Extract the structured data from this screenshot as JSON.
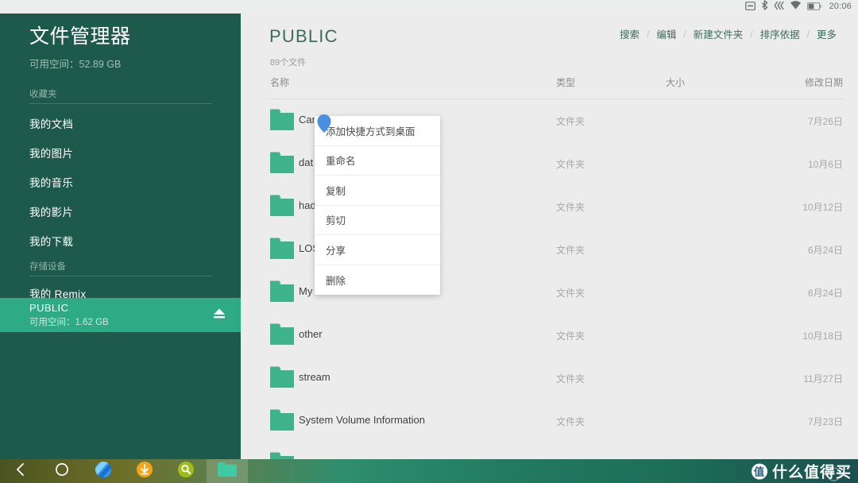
{
  "statusbar": {
    "time": "20:06",
    "icons": [
      "screencast-icon",
      "bluetooth-icon",
      "sync-icon",
      "wifi-icon",
      "battery-icon"
    ]
  },
  "sidebar": {
    "title": "文件管理器",
    "subtitle": "可用空间：52.89 GB",
    "sections": [
      {
        "label": "收藏夹"
      },
      {
        "label": "存储设备"
      }
    ],
    "favorites": [
      {
        "label": "我的文档"
      },
      {
        "label": "我的图片"
      },
      {
        "label": "我的音乐"
      },
      {
        "label": "我的影片"
      },
      {
        "label": "我的下载"
      }
    ],
    "storage": [
      {
        "label": "我的 Remix",
        "active": false
      },
      {
        "label": "PUBLIC",
        "sublabel": "可用空间：1.62 GB",
        "active": true,
        "eject": "eject-icon"
      }
    ],
    "bg_color": "#1e5a4b",
    "active_color": "#2eab84"
  },
  "main": {
    "title": "PUBLIC",
    "count": "89个文件",
    "actions": [
      {
        "label": "搜索"
      },
      {
        "label": "编辑"
      },
      {
        "label": "新建文件夹"
      },
      {
        "label": "排序依据"
      },
      {
        "label": "更多"
      }
    ],
    "action_separator": "/",
    "columns": {
      "name": "名称",
      "type": "类型",
      "size": "大小",
      "date": "修改日期"
    },
    "files": [
      {
        "name": "Camera",
        "type": "文件夹",
        "size": "",
        "date": "7月26日"
      },
      {
        "name": "dat",
        "type": "文件夹",
        "size": "",
        "date": "10月6日"
      },
      {
        "name": "had",
        "type": "文件夹",
        "size": "",
        "date": "10月12日"
      },
      {
        "name": "LOS",
        "type": "文件夹",
        "size": "",
        "date": "6月24日"
      },
      {
        "name": "My",
        "type": "文件夹",
        "size": "",
        "date": "6月24日"
      },
      {
        "name": "other",
        "type": "文件夹",
        "size": "",
        "date": "10月18日"
      },
      {
        "name": "stream",
        "type": "文件夹",
        "size": "",
        "date": "11月27日"
      },
      {
        "name": "System Volume Information",
        "type": "文件夹",
        "size": "",
        "date": "7月23日"
      }
    ],
    "folder_color": "#3fb48c"
  },
  "context_menu": {
    "items": [
      {
        "label": "添加快捷方式到桌面"
      },
      {
        "label": "重命名"
      },
      {
        "label": "复制"
      },
      {
        "label": "剪切"
      },
      {
        "label": "分享"
      },
      {
        "label": "删除"
      }
    ]
  },
  "taskbar": {
    "items": [
      {
        "name": "back-icon"
      },
      {
        "name": "home-icon"
      },
      {
        "name": "browser-icon"
      },
      {
        "name": "download-icon"
      },
      {
        "name": "search-app-icon"
      },
      {
        "name": "file-manager-icon",
        "active": true
      }
    ],
    "watermark": {
      "badge": "值",
      "text": "什么值得买"
    }
  }
}
